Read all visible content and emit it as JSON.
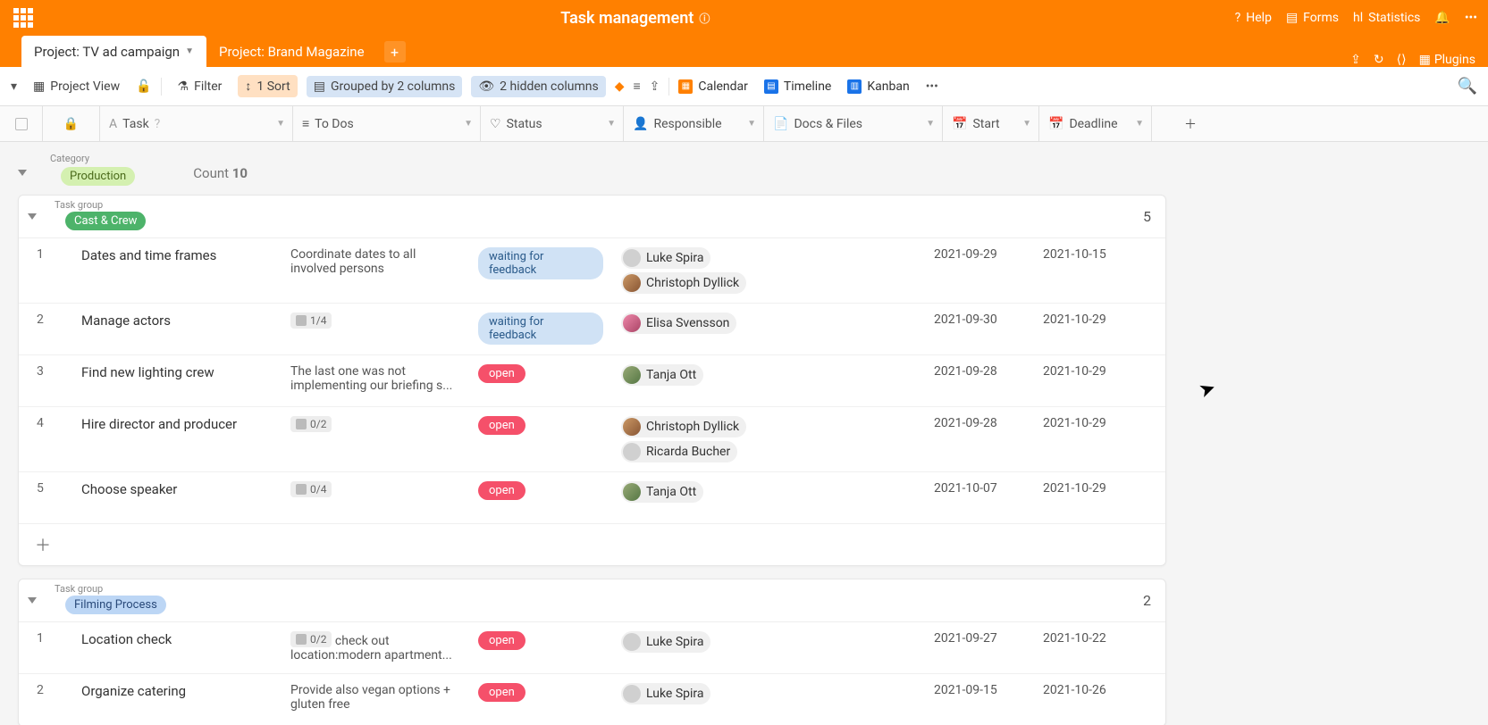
{
  "app": {
    "title": "Task management"
  },
  "topnav": {
    "help": "Help",
    "forms": "Forms",
    "statistics": "Statistics"
  },
  "tabs": {
    "active": "Project: TV ad campaign",
    "inactive": "Project: Brand Magazine",
    "plugins": "Plugins"
  },
  "toolbar": {
    "view": "Project View",
    "filter": "Filter",
    "sort": "1 Sort",
    "group": "Grouped by 2 columns",
    "hidden": "2 hidden columns",
    "calendar": "Calendar",
    "timeline": "Timeline",
    "kanban": "Kanban"
  },
  "columns": {
    "task": "Task",
    "todos": "To Dos",
    "status": "Status",
    "responsible": "Responsible",
    "docs": "Docs & Files",
    "start": "Start",
    "deadline": "Deadline"
  },
  "labels": {
    "category": "Category",
    "taskgroup": "Task group",
    "count": "Count"
  },
  "category": {
    "name": "Production",
    "count": "10"
  },
  "groups": [
    {
      "name": "Cast & Crew",
      "chipClass": "cast",
      "count": "5",
      "rows": [
        {
          "n": "1",
          "task": "Dates and time frames",
          "todo_text": "Coordinate dates to all involved persons",
          "todo_chip": "",
          "status": "waiting for feedback",
          "statusClass": "st-wait",
          "people": [
            {
              "name": "Luke Spira",
              "av": "av-grey"
            },
            {
              "name": "Christoph Dyllick",
              "av": "av1"
            }
          ],
          "start": "2021-09-29",
          "dead": "2021-10-15"
        },
        {
          "n": "2",
          "task": "Manage actors",
          "todo_text": "",
          "todo_chip": "1/4",
          "status": "waiting for feedback",
          "statusClass": "st-wait",
          "people": [
            {
              "name": "Elisa Svensson",
              "av": "av2"
            }
          ],
          "start": "2021-09-30",
          "dead": "2021-10-29"
        },
        {
          "n": "3",
          "task": "Find new lighting crew",
          "todo_text": "The last one was not implementing our briefing s...",
          "todo_chip": "",
          "status": "open",
          "statusClass": "st-open",
          "people": [
            {
              "name": "Tanja Ott",
              "av": "av3"
            }
          ],
          "start": "2021-09-28",
          "dead": "2021-10-29"
        },
        {
          "n": "4",
          "task": "Hire director and producer",
          "todo_text": "",
          "todo_chip": "0/2",
          "status": "open",
          "statusClass": "st-open",
          "people": [
            {
              "name": "Christoph Dyllick",
              "av": "av1"
            },
            {
              "name": "Ricarda Bucher",
              "av": "av-grey"
            }
          ],
          "start": "2021-09-28",
          "dead": "2021-10-29"
        },
        {
          "n": "5",
          "task": "Choose speaker",
          "todo_text": "",
          "todo_chip": "0/4",
          "status": "open",
          "statusClass": "st-open",
          "people": [
            {
              "name": "Tanja Ott",
              "av": "av3"
            }
          ],
          "start": "2021-10-07",
          "dead": "2021-10-29"
        }
      ]
    },
    {
      "name": "Filming Process",
      "chipClass": "film",
      "count": "2",
      "rows": [
        {
          "n": "1",
          "task": "Location check",
          "todo_text": "check out location:modern apartment...",
          "todo_chip": "0/2",
          "status": "open",
          "statusClass": "st-open",
          "people": [
            {
              "name": "Luke Spira",
              "av": "av-grey"
            }
          ],
          "start": "2021-09-27",
          "dead": "2021-10-22"
        },
        {
          "n": "2",
          "task": "Organize catering",
          "todo_text": "Provide also vegan options + gluten free",
          "todo_chip": "",
          "status": "open",
          "statusClass": "st-open",
          "people": [
            {
              "name": "Luke Spira",
              "av": "av-grey"
            }
          ],
          "start": "2021-09-15",
          "dead": "2021-10-26"
        }
      ]
    }
  ]
}
